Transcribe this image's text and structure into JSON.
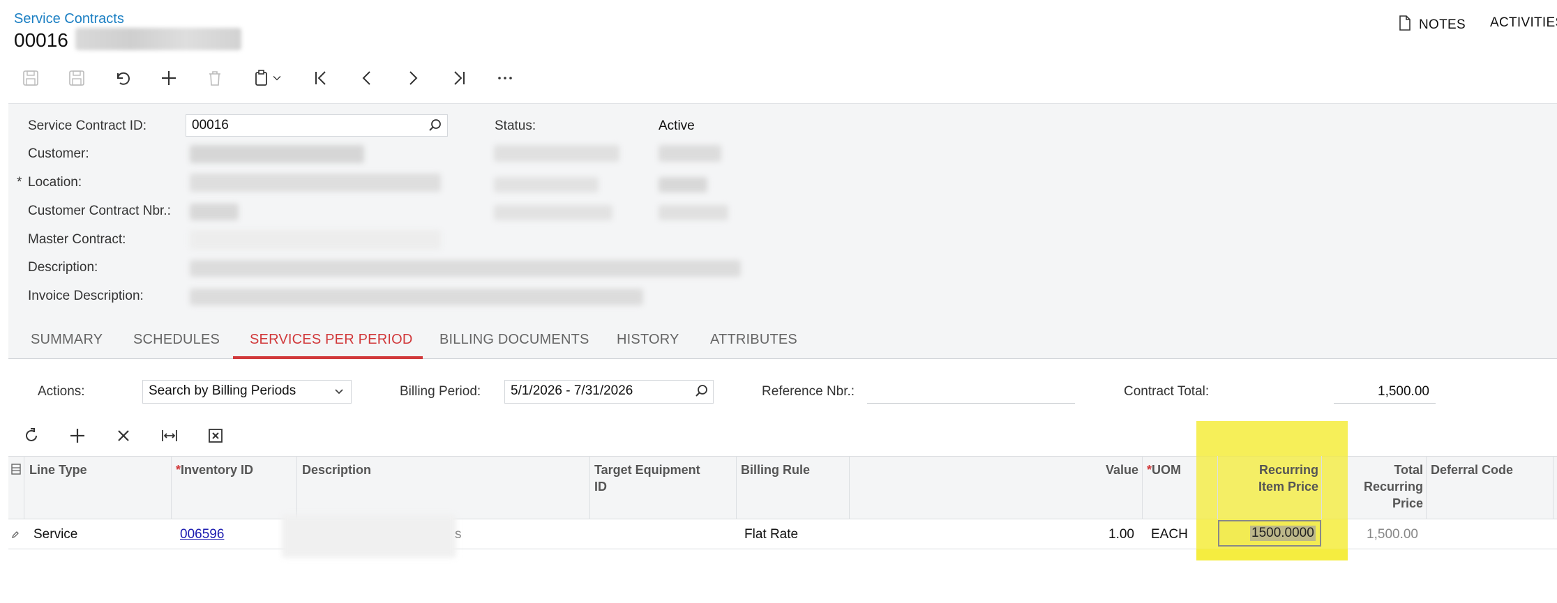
{
  "header": {
    "breadcrumb": "Service Contracts",
    "title": "00016",
    "notes_label": "NOTES",
    "activities_label": "ACTIVITIES"
  },
  "toolbar": {
    "icons": [
      "save-icon",
      "save-close-icon",
      "undo-icon",
      "add-icon",
      "delete-icon",
      "clipboard-icon",
      "first-record-icon",
      "previous-icon",
      "next-icon",
      "last-record-icon",
      "more-icon"
    ]
  },
  "form": {
    "contract_id_label": "Service Contract ID:",
    "contract_id_value": "00016",
    "customer_label": "Customer:",
    "location_label": "Location:",
    "customer_contract_label": "Customer Contract Nbr.:",
    "master_contract_label": "Master Contract:",
    "description_label": "Description:",
    "invoice_description_label": "Invoice Description:",
    "status_label": "Status:",
    "status_value": "Active",
    "required_marker": "*"
  },
  "tabs": [
    {
      "label": "SUMMARY",
      "active": false
    },
    {
      "label": "SCHEDULES",
      "active": false
    },
    {
      "label": "SERVICES PER PERIOD",
      "active": true
    },
    {
      "label": "BILLING DOCUMENTS",
      "active": false
    },
    {
      "label": "HISTORY",
      "active": false
    },
    {
      "label": "ATTRIBUTES",
      "active": false
    }
  ],
  "filters": {
    "actions_label": "Actions:",
    "actions_value": "Search by Billing Periods",
    "billing_period_label": "Billing Period:",
    "billing_period_value": "5/1/2026 - 7/31/2026",
    "reference_label": "Reference Nbr.:",
    "reference_value": "",
    "contract_total_label": "Contract Total:",
    "contract_total_value": "1,500.00"
  },
  "grid_toolbar": {
    "icons": [
      "refresh-icon",
      "add-row-icon",
      "delete-row-icon",
      "fit-columns-icon",
      "export-excel-icon"
    ]
  },
  "grid": {
    "columns": {
      "line_type": "Line Type",
      "inventory_id": "Inventory ID",
      "description": "Description",
      "target_equipment_1": "Target Equipment",
      "target_equipment_2": "ID",
      "billing_rule": "Billing Rule",
      "value": "Value",
      "uom": "UOM",
      "recurring_price_1": "Recurring",
      "recurring_price_2": "Item Price",
      "total_recurring_1": "Total",
      "total_recurring_2": "Recurring",
      "total_recurring_3": "Price",
      "deferral_code": "Deferral Code"
    },
    "row": {
      "line_type": "Service",
      "inventory_id": "006596",
      "description_tail": "s",
      "billing_rule": "Flat Rate",
      "value": "1.00",
      "uom": "EACH",
      "recurring_item_price": "1500.0000",
      "total_recurring_price": "1,500.00"
    }
  },
  "colors": {
    "link": "#1b7fc3",
    "active_tab": "#d1393b",
    "highlight": "#f4ec3c"
  }
}
